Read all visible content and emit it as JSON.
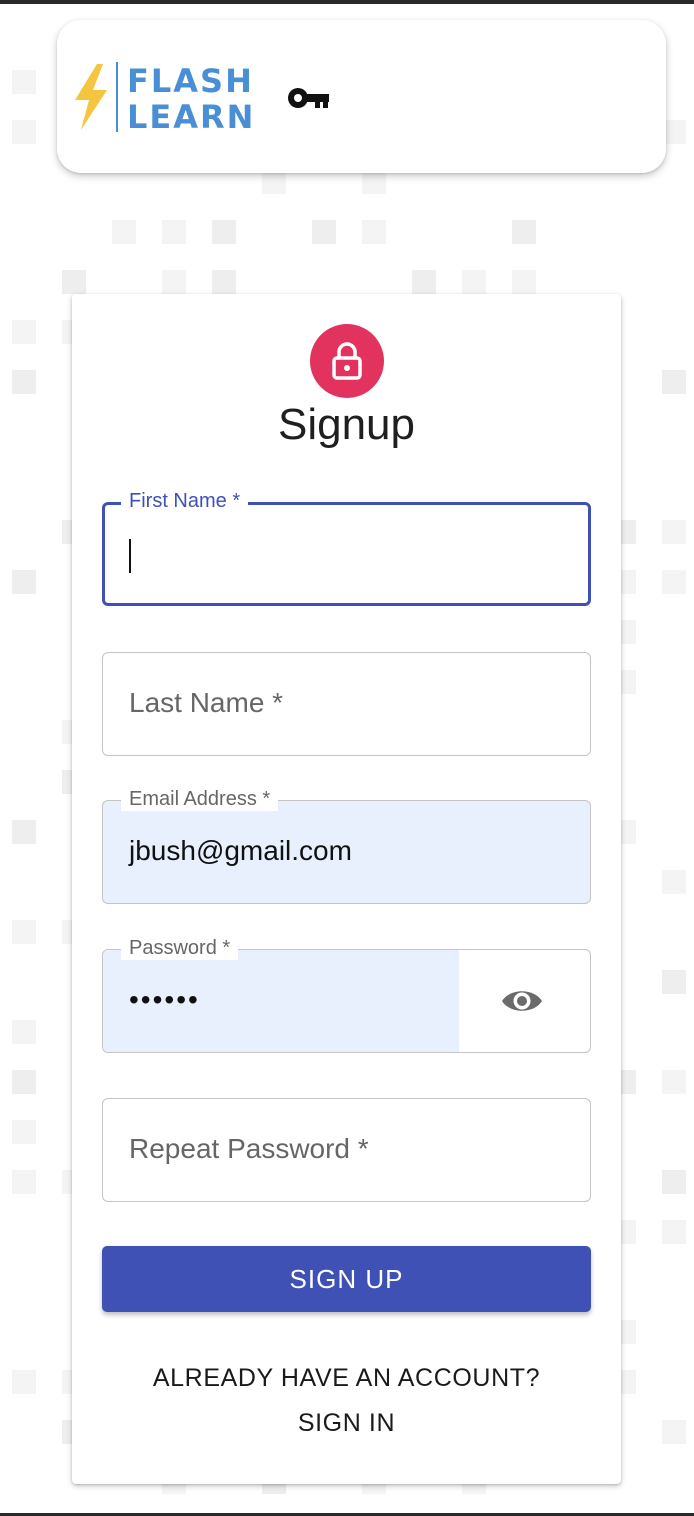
{
  "header": {
    "logo_line1": "FLASH",
    "logo_line2": "LEARN",
    "logo_icon": "lightning-bolt-icon",
    "nav_icon": "key-icon"
  },
  "form": {
    "icon": "lock-icon",
    "title": "Signup",
    "fields": {
      "first_name": {
        "label": "First Name *",
        "value": ""
      },
      "last_name": {
        "placeholder": "Last Name *"
      },
      "email": {
        "label": "Email Address *",
        "value": "jbush@gmail.com"
      },
      "password": {
        "label": "Password *",
        "value": "••••••",
        "toggle_icon": "eye-icon"
      },
      "repeat_password": {
        "placeholder": "Repeat Password *"
      }
    },
    "submit_label": "SIGN UP",
    "signin_line1": "ALREADY HAVE AN ACCOUNT?",
    "signin_line2": "SIGN IN"
  },
  "colors": {
    "primary": "#3f51b5",
    "avatar": "#e2335e",
    "autofill": "#e8f0fe",
    "logo_bolt": "#f5c542",
    "logo_text": "#4a8fd6"
  }
}
